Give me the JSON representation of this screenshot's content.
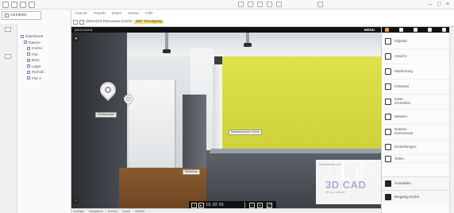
{
  "app": {
    "left_tab_label": "countries",
    "tree": [
      "Datenbank",
      "Räume",
      "Küche",
      "Flur",
      "Büro",
      "Lager",
      "Technik",
      "Flur 2"
    ]
  },
  "main": {
    "tabs": [
      "Ansicht",
      "Projekt",
      "Daten",
      "Extras",
      "Hilfe"
    ],
    "path": "Übersicht  Panorama  Küche",
    "path_tail": "360° Rundgang"
  },
  "viewer": {
    "logo": "panorama",
    "mode": "MENU",
    "labels": [
      "Kühlschrank",
      "Wasserkocher Küche",
      "Mülleimer"
    ],
    "cad_title": "www.3dcad.com",
    "cad_big": "3D CAD",
    "cad_sub": "3D cad software",
    "footer_text": "01  02  03",
    "status": [
      "Anzeige",
      "Navigation",
      "Drehen",
      "Zoom",
      "Vollbild"
    ]
  },
  "right_panel": {
    "items": [
      {
        "label": "Objekte"
      },
      {
        "label": "Ansicht"
      },
      {
        "label": "Markierung"
      },
      {
        "label": "Hotspots"
      },
      {
        "label": "Karte",
        "sub": "Grundriss"
      },
      {
        "label": "Messen"
      },
      {
        "label": "Notizen",
        "sub": "Kommentar"
      },
      {
        "label": "Einstellungen"
      },
      {
        "label": "Teilen"
      },
      {
        "label": "Export"
      }
    ],
    "bottom": [
      {
        "label": "Anmelden"
      },
      {
        "label": "Eingang Küche"
      }
    ]
  },
  "colors": {
    "accent_orange": "#f39c33",
    "wall_yellow": "#dfe14a"
  }
}
